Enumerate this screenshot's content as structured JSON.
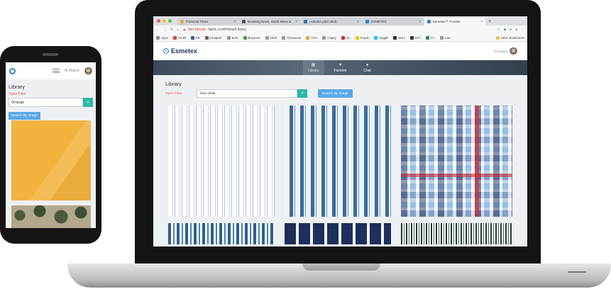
{
  "browser": {
    "tabs": [
      {
        "label": "Financial Times",
        "color": "#e8a94d"
      },
      {
        "label": "Breaking News, World News &",
        "color": "#555555"
      },
      {
        "label": "LinkedIn pitch deck",
        "color": "#2f6fb3"
      },
      {
        "label": "ESMETEX",
        "color": "#2a86c9"
      },
      {
        "label": "Esmetex™ Frontier",
        "color": "#2a86c9"
      }
    ],
    "not_secure": "Not Secure",
    "url": "fabric.cool/Home/Library",
    "bookmarks": [
      {
        "label": "Apps",
        "color": "#888888"
      },
      {
        "label": "Gmail",
        "color": "#d44638"
      },
      {
        "label": "FB",
        "color": "#3b5998"
      },
      {
        "label": "Dividpert",
        "color": "#666666"
      },
      {
        "label": "Born",
        "color": "#999999"
      },
      {
        "label": "Bonanza",
        "color": "#46a046"
      },
      {
        "label": "GEO",
        "color": "#999999"
      },
      {
        "label": "Thesaurus",
        "color": "#999999"
      },
      {
        "label": "TGA",
        "color": "#e0a63c"
      },
      {
        "label": "CapIQ",
        "color": "#999999"
      },
      {
        "label": "SC",
        "color": "#c33333"
      },
      {
        "label": "Purple",
        "color": "#f3c000"
      },
      {
        "label": "Kaggle",
        "color": "#20beff"
      },
      {
        "label": "WSJ",
        "color": "#333333"
      },
      {
        "label": "NYT",
        "color": "#333333"
      },
      {
        "label": "FC",
        "color": "#2e8b57"
      },
      {
        "label": "Law",
        "color": "#999999"
      }
    ],
    "other_bookmarks": "Other Bookmarks"
  },
  "app": {
    "brand": "Esmetex",
    "greeting": "Hi,Wayne",
    "nav": [
      {
        "label": "Library",
        "icon": "library-icon"
      },
      {
        "label": "Favorite",
        "icon": "favorite-icon"
      },
      {
        "label": "Chat",
        "icon": "chat-icon"
      }
    ],
    "page_title": "Library",
    "open_filter": "Open Filter",
    "search_value": "blue white",
    "search_by_image": "Search By Image"
  },
  "phone": {
    "greeting": "Hi,Wayne",
    "page_title": "Library",
    "open_filter": "Open Filter",
    "search_value": "Orange",
    "search_by_image": "Search By Image"
  },
  "colors": {
    "accent": "#2fb8a6",
    "button_blue": "#5aa8e6",
    "filter_red": "#e65a5a",
    "brand_blue": "#2a86c9"
  }
}
